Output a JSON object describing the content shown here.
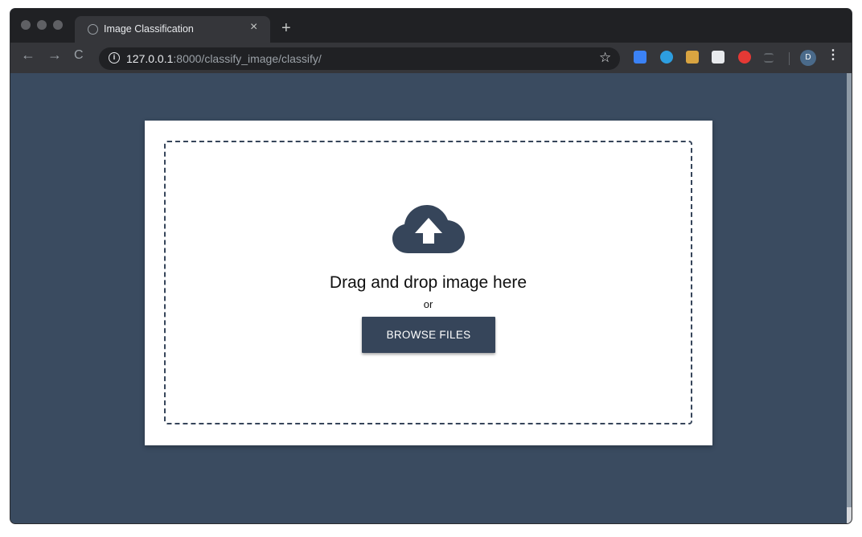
{
  "browser": {
    "tab": {
      "title": "Image Classification",
      "close_glyph": "×"
    },
    "new_tab_glyph": "+",
    "nav": {
      "back_glyph": "←",
      "forward_glyph": "→",
      "reload_glyph": "C"
    },
    "url": {
      "host": "127.0.0.1",
      "rest": ":8000/classify_image/classify/"
    },
    "bookmark_glyph": "☆",
    "extensions": [
      {
        "name": "s-extension-icon",
        "color": "#3b82f6"
      },
      {
        "name": "v-extension-icon",
        "color": "#2d9ee0"
      },
      {
        "name": "character-extension-icon",
        "color": "#d9a441"
      },
      {
        "name": "grid-extension-icon",
        "color": "#e8eaed"
      },
      {
        "name": "adblock-hand-icon",
        "color": "#e53935"
      },
      {
        "name": "list-extension-icon",
        "color": "#5f6368"
      }
    ],
    "profile_initial": "D",
    "menu_glyph": "⋮"
  },
  "page": {
    "background_color": "#3a4b60",
    "upload": {
      "icon": "cloud-upload-icon",
      "headline": "Drag and drop image here",
      "separator": "or",
      "button_label": "BROWSE FILES"
    }
  }
}
